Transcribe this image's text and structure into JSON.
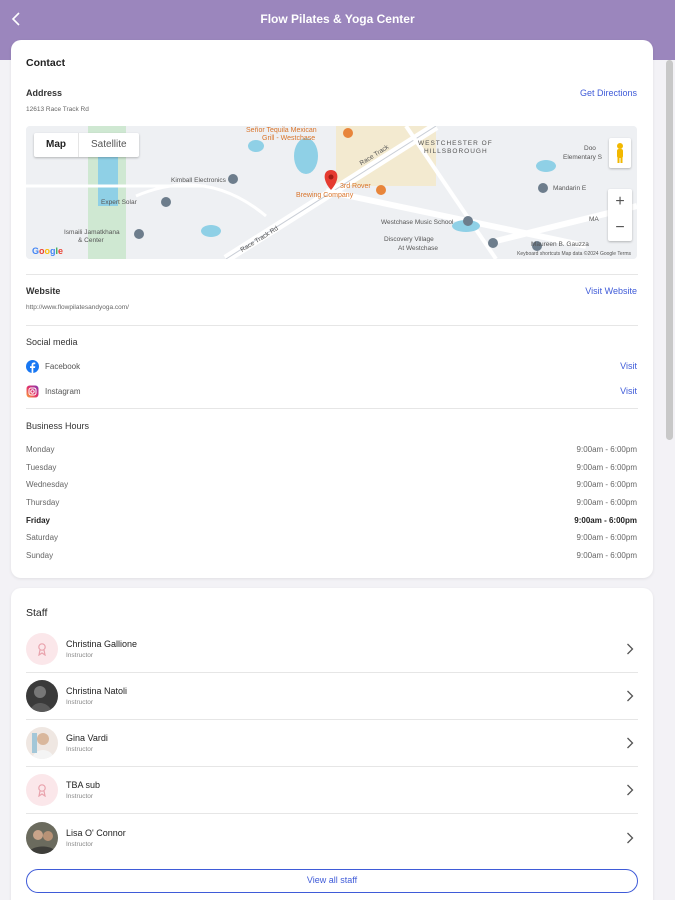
{
  "header": {
    "title": "Flow Pilates & Yoga Center"
  },
  "contact": {
    "section_title": "Contact",
    "address_label": "Address",
    "address_value": "12613 Race Track Rd",
    "directions_label": "Get Directions",
    "map": {
      "map_tab": "Map",
      "satellite_tab": "Satellite",
      "zoom_in": "+",
      "zoom_out": "−",
      "labels": {
        "senor": "Señor Tequila Mexican",
        "senor2": "Grill - Westchase",
        "westchester": "WESTCHESTER OF",
        "hillsborough": "HILLSBOROUGH",
        "kimball": "Kimball Electronics",
        "expert": "Expert Solar",
        "ismaili": "Ismaili Jamatkhana",
        "center": "& Center",
        "brewing": "3rd Rover",
        "brewing2": "Brewing Company",
        "music": "Westchase Music School",
        "discovery": "Discovery Village",
        "discovery2": "At Westchase",
        "mandarin": "Mandarin E",
        "maureen": "Maureen B. Gauzza",
        "elem": "Elementary S",
        "road": "Race Track Rd",
        "road2": "Race Track",
        "ma": "MA",
        "doo": "Doo"
      },
      "google": "Google",
      "footer": "Keyboard shortcuts   Map data ©2024 Google   Terms"
    },
    "website_label": "Website",
    "website_value": "http://www.flowpilatesandyoga.com/",
    "visit_website_label": "Visit Website",
    "social_label": "Social media",
    "social": [
      {
        "name": "Facebook",
        "action": "Visit"
      },
      {
        "name": "Instagram",
        "action": "Visit"
      }
    ],
    "hours_label": "Business Hours",
    "hours": [
      {
        "day": "Monday",
        "time": "9:00am - 6:00pm"
      },
      {
        "day": "Tuesday",
        "time": "9:00am - 6:00pm"
      },
      {
        "day": "Wednesday",
        "time": "9:00am - 6:00pm"
      },
      {
        "day": "Thursday",
        "time": "9:00am - 6:00pm"
      },
      {
        "day": "Friday",
        "time": "9:00am - 6:00pm"
      },
      {
        "day": "Saturday",
        "time": "9:00am - 6:00pm"
      },
      {
        "day": "Sunday",
        "time": "9:00am - 6:00pm"
      }
    ]
  },
  "staff": {
    "section_title": "Staff",
    "members": [
      {
        "name": "Christina Gallione",
        "role": "Instructor"
      },
      {
        "name": "Christina Natoli",
        "role": "Instructor"
      },
      {
        "name": "Gina Vardi",
        "role": "Instructor"
      },
      {
        "name": "TBA sub",
        "role": "Instructor"
      },
      {
        "name": "Lisa O' Connor",
        "role": "Instructor"
      }
    ],
    "view_all_label": "View all staff"
  },
  "colors": {
    "header": "#9b86bd",
    "link": "#3f5bd8"
  }
}
